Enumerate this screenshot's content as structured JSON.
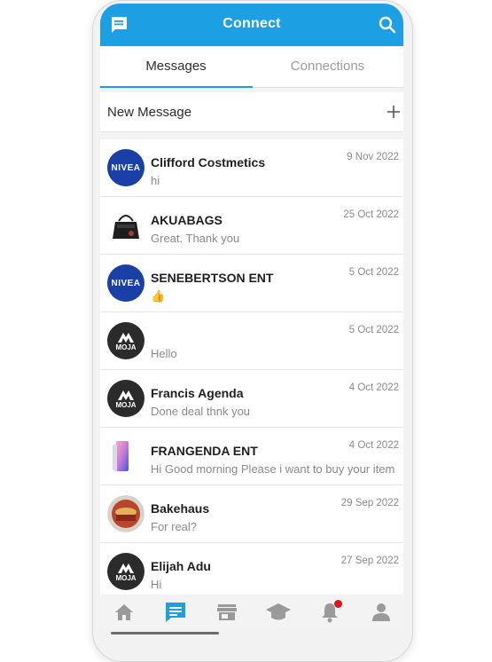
{
  "header": {
    "title": "Connect",
    "accent_color": "#1c9fe3",
    "left_icon": "chat-bubble-icon",
    "right_icon": "search-icon"
  },
  "tabs": [
    {
      "label": "Messages",
      "active": true
    },
    {
      "label": "Connections",
      "active": false
    }
  ],
  "new_message": {
    "label": "New Message",
    "icon": "plus-icon"
  },
  "conversations": [
    {
      "name": "Clifford Costmetics",
      "preview": "hi",
      "date": "9 Nov 2022",
      "avatar": "nivea-logo",
      "avatar_text": "NIVEA"
    },
    {
      "name": "AKUABAGS",
      "preview": "Great. Thank you",
      "date": "25 Oct 2022",
      "avatar": "handbag-image",
      "avatar_text": ""
    },
    {
      "name": "SENEBERTSON ENT",
      "preview": "👍",
      "date": "5 Oct 2022",
      "avatar": "nivea-logo",
      "avatar_text": "NIVEA"
    },
    {
      "name": "",
      "preview": "Hello",
      "date": "5 Oct 2022",
      "avatar": "moja-logo",
      "avatar_text": "MOJA"
    },
    {
      "name": "Francis Agenda",
      "preview": "Done deal thnk you",
      "date": "4 Oct 2022",
      "avatar": "moja-logo",
      "avatar_text": "MOJA"
    },
    {
      "name": "FRANGENDA ENT",
      "preview": "Hi Good morning  Please i want to buy your item",
      "date": "4 Oct 2022",
      "avatar": "phone-image",
      "avatar_text": ""
    },
    {
      "name": "Bakehaus",
      "preview": "For real?",
      "date": "29 Sep 2022",
      "avatar": "pastry-image",
      "avatar_text": ""
    },
    {
      "name": "Elijah Adu",
      "preview": "Hi",
      "date": "27 Sep 2022",
      "avatar": "moja-logo",
      "avatar_text": "MOJA"
    }
  ],
  "bottom_nav": [
    {
      "icon": "home-icon",
      "active": false
    },
    {
      "icon": "messages-icon",
      "active": true
    },
    {
      "icon": "store-icon",
      "active": false
    },
    {
      "icon": "graduation-cap-icon",
      "active": false
    },
    {
      "icon": "bell-icon",
      "active": false,
      "has_badge": true
    },
    {
      "icon": "profile-icon",
      "active": false
    }
  ]
}
